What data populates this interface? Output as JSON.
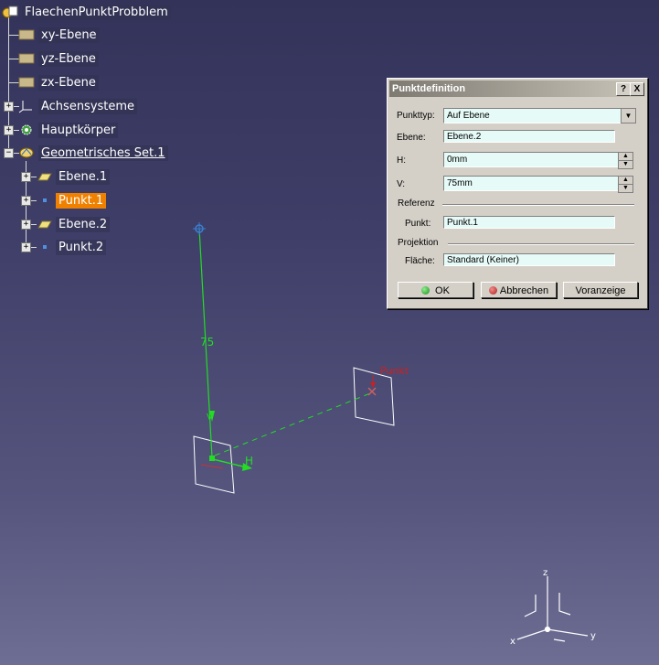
{
  "tree": {
    "root": "FlaechenPunktProbblem",
    "items": [
      {
        "label": "xy-Ebene"
      },
      {
        "label": "yz-Ebene"
      },
      {
        "label": "zx-Ebene"
      },
      {
        "label": "Achsensysteme"
      },
      {
        "label": "Hauptkörper"
      },
      {
        "label": "Geometrisches Set.1"
      },
      {
        "label": "Ebene.1"
      },
      {
        "label": "Punkt.1"
      },
      {
        "label": "Ebene.2"
      },
      {
        "label": "Punkt.2"
      }
    ]
  },
  "dialog": {
    "title": "Punktdefinition",
    "help_btn": "?",
    "close_btn": "X",
    "punkttyp_label": "Punkttyp:",
    "punkttyp_value": "Auf Ebene",
    "ebene_label": "Ebene:",
    "ebene_value": "Ebene.2",
    "h_label": "H:",
    "h_value": "0mm",
    "v_label": "V:",
    "v_value": "75mm",
    "referenz_section": "Referenz",
    "punkt_label": "Punkt:",
    "punkt_value": "Punkt.1",
    "projektion_section": "Projektion",
    "flaeche_label": "Fläche:",
    "flaeche_value": "Standard (Keiner)",
    "ok": "OK",
    "cancel": "Abbrechen",
    "preview": "Voranzeige"
  },
  "viewport": {
    "dimension": "75",
    "h_axis": "H",
    "v_axis": "V",
    "point_label": "Punkt",
    "compass_x": "x",
    "compass_y": "y",
    "compass_z": "z"
  },
  "colors": {
    "selection": "#f08000",
    "field_bg": "#e6fbf7",
    "construction": "#22dd22",
    "point_label": "#cc2020"
  }
}
